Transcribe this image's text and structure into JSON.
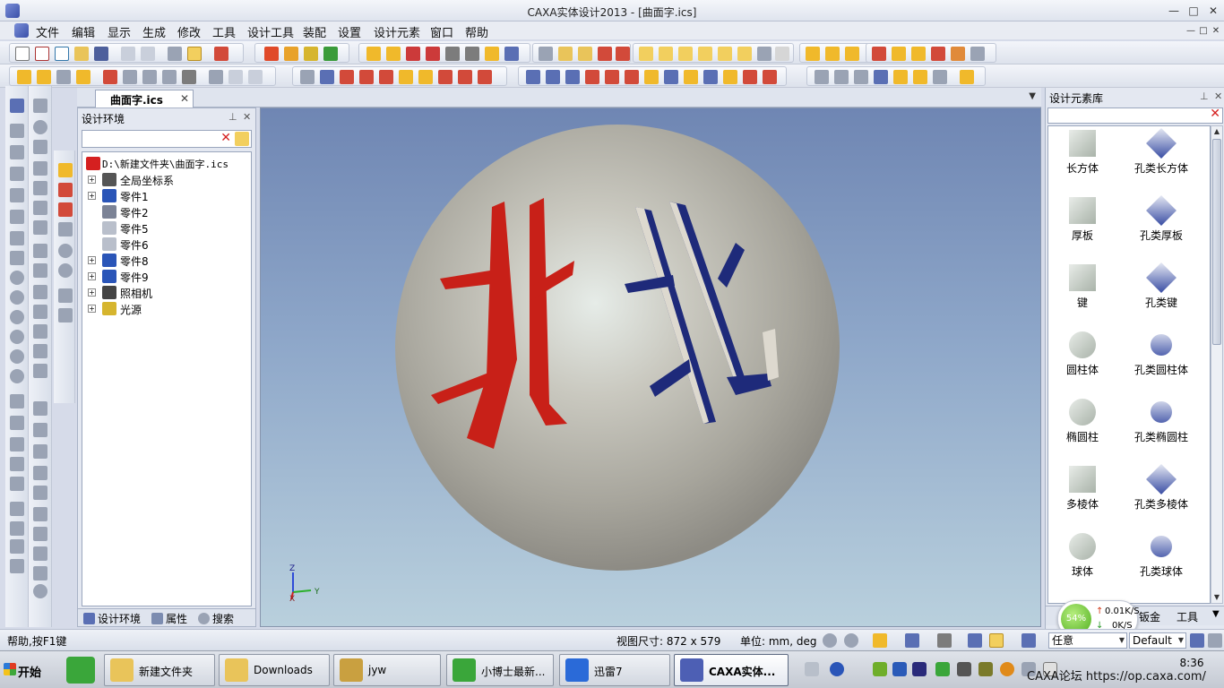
{
  "window": {
    "title": "CAXA实体设计2013 - [曲面字.ics]",
    "min": "—",
    "max": "□",
    "close": "✕"
  },
  "menu": [
    "文件",
    "编辑",
    "显示",
    "生成",
    "修改",
    "工具",
    "设计工具",
    "装配",
    "设置",
    "设计元素",
    "窗口",
    "帮助"
  ],
  "document_tab": {
    "label": "曲面字.ics",
    "close": "✕"
  },
  "design_env": {
    "title": "设计环境",
    "tree": [
      {
        "label": "D:\\新建文件夹\\曲面字.ics",
        "expandable": false,
        "icon": "scene-root-icon"
      },
      {
        "label": "全局坐标系",
        "expandable": true,
        "icon": "coordinate-axes-icon"
      },
      {
        "label": "零件1",
        "expandable": true,
        "icon": "part-icon"
      },
      {
        "label": "零件2",
        "expandable": false,
        "icon": "part-gray-icon"
      },
      {
        "label": "零件5",
        "expandable": false,
        "icon": "surface-icon"
      },
      {
        "label": "零件6",
        "expandable": false,
        "icon": "surface-icon"
      },
      {
        "label": "零件8",
        "expandable": true,
        "icon": "part-icon"
      },
      {
        "label": "零件9",
        "expandable": true,
        "icon": "part-icon"
      },
      {
        "label": "照相机",
        "expandable": true,
        "icon": "camera-icon"
      },
      {
        "label": "光源",
        "expandable": true,
        "icon": "light-icon"
      }
    ],
    "tabs": [
      "设计环境",
      "属性",
      "搜索"
    ]
  },
  "design_library": {
    "title": "设计元素库",
    "items": [
      {
        "label": "长方体",
        "icon": "box-icon"
      },
      {
        "label": "孔类长方体",
        "icon": "hole-box-icon"
      },
      {
        "label": "厚板",
        "icon": "plate-icon"
      },
      {
        "label": "孔类厚板",
        "icon": "hole-plate-icon"
      },
      {
        "label": "键",
        "icon": "key-icon"
      },
      {
        "label": "孔类键",
        "icon": "hole-key-icon"
      },
      {
        "label": "圆柱体",
        "icon": "cylinder-icon"
      },
      {
        "label": "孔类圆柱体",
        "icon": "hole-cylinder-icon"
      },
      {
        "label": "椭圆柱",
        "icon": "elliptic-cylinder-icon"
      },
      {
        "label": "孔类椭圆柱",
        "icon": "hole-elliptic-cylinder-icon"
      },
      {
        "label": "多棱体",
        "icon": "prism-icon"
      },
      {
        "label": "孔类多棱体",
        "icon": "hole-prism-icon"
      },
      {
        "label": "球体",
        "icon": "sphere-icon"
      },
      {
        "label": "孔类球体",
        "icon": "hole-sphere-icon"
      }
    ],
    "bottom_tabs": [
      "钣金",
      "工具"
    ]
  },
  "viewport": {
    "text_left": "北",
    "text_right": "北",
    "colors": {
      "sphere": "#c8c6bd",
      "text_left": "#c82018",
      "text_right": "#1e2a7a"
    },
    "axes": {
      "z": "Z",
      "y": "Y",
      "x": "X"
    }
  },
  "status": {
    "help": "帮助,按F1键",
    "view_size": "视图尺寸: 872 x 579",
    "units": "单位: mm, deg",
    "filter": "任意",
    "style": "Default"
  },
  "speed": {
    "percent": "54%",
    "up": "0.01K/S",
    "down": "0K/S"
  },
  "taskbar": {
    "start": "开始",
    "buttons": [
      {
        "label": "新建文件夹",
        "icon": "folder-icon"
      },
      {
        "label": "Downloads",
        "icon": "folder-icon"
      },
      {
        "label": "jyw",
        "icon": "user-folder-icon"
      },
      {
        "label": "小博士最新...",
        "icon": "browser-icon"
      },
      {
        "label": "迅雷7",
        "icon": "thunder-icon"
      },
      {
        "label": "CAXA实体...",
        "icon": "caxa-icon"
      }
    ],
    "clock": "8:36",
    "watermark": "CAXA论坛 https://op.caxa.com/"
  }
}
